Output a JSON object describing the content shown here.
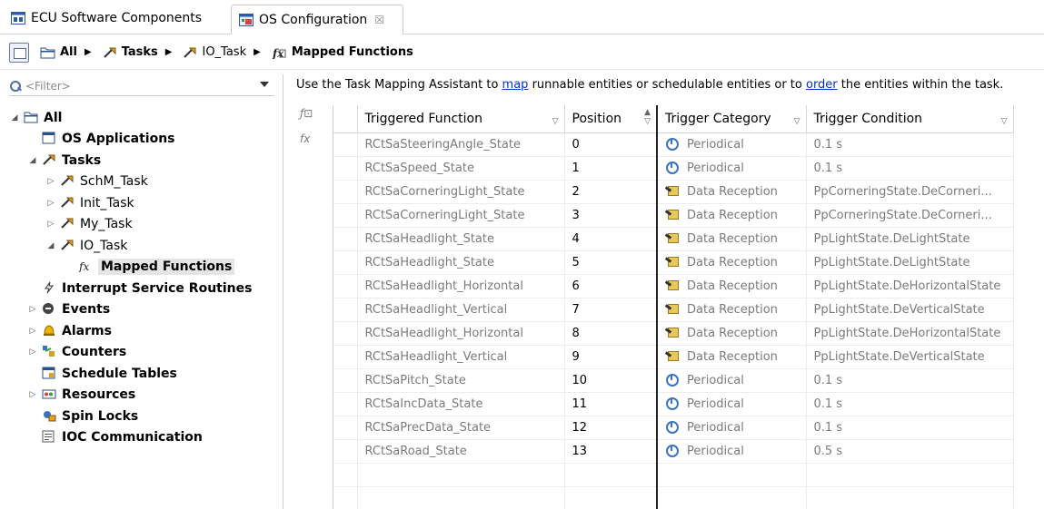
{
  "tabs": [
    {
      "label": "ECU Software Components",
      "active": false
    },
    {
      "label": "OS Configuration",
      "active": true,
      "close": "☒"
    }
  ],
  "breadcrumb": [
    {
      "label": "All",
      "bold": true,
      "icon": "folder-icon"
    },
    {
      "label": "Tasks",
      "bold": true,
      "icon": "task-icon"
    },
    {
      "label": "IO_Task",
      "bold": false,
      "icon": "task-icon"
    },
    {
      "label": "Mapped Functions",
      "bold": true,
      "icon": "function-icon"
    }
  ],
  "filter": {
    "placeholder": "<Filter>"
  },
  "tree": [
    {
      "label": "All",
      "level": 0,
      "twisty": "open",
      "icon": "folder-icon",
      "bold": true
    },
    {
      "label": "OS Applications",
      "level": 1,
      "twisty": "",
      "icon": "application-icon",
      "bold": true
    },
    {
      "label": "Tasks",
      "level": 1,
      "twisty": "open",
      "icon": "task-icon",
      "bold": true
    },
    {
      "label": "SchM_Task",
      "level": 2,
      "twisty": "closed",
      "icon": "task-icon",
      "bold": false
    },
    {
      "label": "Init_Task",
      "level": 2,
      "twisty": "closed",
      "icon": "task-icon",
      "bold": false
    },
    {
      "label": "My_Task",
      "level": 2,
      "twisty": "closed",
      "icon": "task-icon",
      "bold": false
    },
    {
      "label": "IO_Task",
      "level": 2,
      "twisty": "open",
      "icon": "task-icon",
      "bold": false
    },
    {
      "label": "Mapped Functions",
      "level": 3,
      "twisty": "",
      "icon": "function-icon",
      "bold": true,
      "selected": true
    },
    {
      "label": "Interrupt Service Routines",
      "level": 1,
      "twisty": "",
      "icon": "interrupt-icon",
      "bold": true
    },
    {
      "label": "Events",
      "level": 1,
      "twisty": "closed",
      "icon": "event-icon",
      "bold": true
    },
    {
      "label": "Alarms",
      "level": 1,
      "twisty": "closed",
      "icon": "alarm-bell-icon",
      "bold": true
    },
    {
      "label": "Counters",
      "level": 1,
      "twisty": "closed",
      "icon": "counter-icon",
      "bold": true
    },
    {
      "label": "Schedule Tables",
      "level": 1,
      "twisty": "",
      "icon": "schedule-table-icon",
      "bold": true
    },
    {
      "label": "Resources",
      "level": 1,
      "twisty": "closed",
      "icon": "resource-icon",
      "bold": true
    },
    {
      "label": "Spin Locks",
      "level": 1,
      "twisty": "",
      "icon": "spin-lock-icon",
      "bold": true
    },
    {
      "label": "IOC Communication",
      "level": 1,
      "twisty": "",
      "icon": "ioc-icon",
      "bold": true
    }
  ],
  "hint": {
    "pre": "Use the Task Mapping Assistant to ",
    "link1": "map",
    "mid": " runnable entities or schedulable entities or to ",
    "link2": "order",
    "post": " the entities within the task."
  },
  "columns": [
    "Triggered Function",
    "Position",
    "Trigger Category",
    "Trigger Condition"
  ],
  "rows": [
    {
      "fn": "RCtSaSteeringAngle_State",
      "pos": "0",
      "cat": "Periodical",
      "cond": "0.1 s"
    },
    {
      "fn": "RCtSaSpeed_State",
      "pos": "1",
      "cat": "Periodical",
      "cond": "0.1 s"
    },
    {
      "fn": "RCtSaCorneringLight_State",
      "pos": "2",
      "cat": "Data Reception",
      "cond": "PpCorneringState.DeCorneri..."
    },
    {
      "fn": "RCtSaCorneringLight_State",
      "pos": "3",
      "cat": "Data Reception",
      "cond": "PpCorneringState.DeCorneri..."
    },
    {
      "fn": "RCtSaHeadlight_State",
      "pos": "4",
      "cat": "Data Reception",
      "cond": "PpLightState.DeLightState"
    },
    {
      "fn": "RCtSaHeadlight_State",
      "pos": "5",
      "cat": "Data Reception",
      "cond": "PpLightState.DeLightState"
    },
    {
      "fn": "RCtSaHeadlight_Horizontal",
      "pos": "6",
      "cat": "Data Reception",
      "cond": "PpLightState.DeHorizontalState"
    },
    {
      "fn": "RCtSaHeadlight_Vertical",
      "pos": "7",
      "cat": "Data Reception",
      "cond": "PpLightState.DeVerticalState"
    },
    {
      "fn": "RCtSaHeadlight_Horizontal",
      "pos": "8",
      "cat": "Data Reception",
      "cond": "PpLightState.DeHorizontalState"
    },
    {
      "fn": "RCtSaHeadlight_Vertical",
      "pos": "9",
      "cat": "Data Reception",
      "cond": "PpLightState.DeVerticalState"
    },
    {
      "fn": "RCtSaPitch_State",
      "pos": "10",
      "cat": "Periodical",
      "cond": "0.1 s"
    },
    {
      "fn": "RCtSaIncData_State",
      "pos": "11",
      "cat": "Periodical",
      "cond": "0.1 s"
    },
    {
      "fn": "RCtSaPrecData_State",
      "pos": "12",
      "cat": "Periodical",
      "cond": "0.1 s"
    },
    {
      "fn": "RCtSaRoad_State",
      "pos": "13",
      "cat": "Periodical",
      "cond": "0.5 s"
    }
  ],
  "empty_rows": 2
}
